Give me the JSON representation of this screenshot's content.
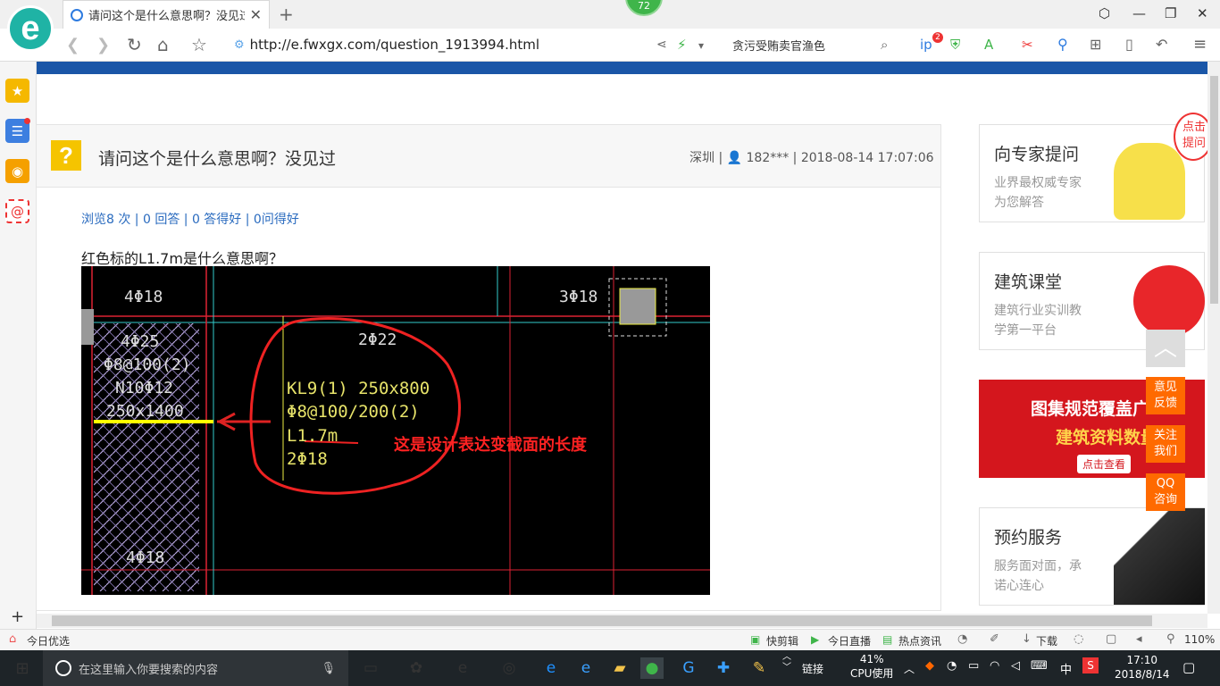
{
  "browser": {
    "tab_title": "请问这个是什么意思啊？没见过_",
    "tab_close": "✕",
    "new_tab": "+",
    "badge_count": "72",
    "url_display": "http://e.fwxgx.com/question_1913994.html",
    "search_value": "贪污受贿卖官渔色",
    "ext_badge": "2"
  },
  "question": {
    "title": "请问这个是什么意思啊？没见过",
    "meta": "深圳 | 👤 182*** | 2018-08-14 17:07:06",
    "stats": "浏览8 次 | 0 回答 | 0 答得好 | 0问得好",
    "body": "红色标的L1.7m是什么意思啊？",
    "icon_char": "?"
  },
  "cad_image": {
    "labels": [
      "4Φ18",
      "3Φ18",
      "4Φ25",
      "Φ8@100(2)",
      "N10Φ12",
      "250x1400",
      "2Φ22",
      "KL9(1) 250x800",
      "Φ8@100/200(2)",
      "L1.7m",
      "2Φ18",
      "4Φ18"
    ],
    "annotation": "这是设计表达变截面的长度"
  },
  "sidebar_cards": [
    {
      "title": "向专家提问",
      "sub": "业界最权威专家为您解答"
    },
    {
      "title": "建筑课堂",
      "sub": "建筑行业实训教学第一平台"
    },
    {
      "title": "预约服务",
      "sub": "服务面对面，承诺心连心"
    }
  ],
  "ad": {
    "line1": "图集规范覆盖广",
    "line2": "建筑资料数量",
    "cta": "点击查看"
  },
  "bubble": "点击提问",
  "float_buttons": [
    "意见反馈",
    "关注我们",
    "QQ咨询"
  ],
  "statusbar": {
    "left": "今日优选",
    "items": [
      "快剪辑",
      "今日直播",
      "热点资讯",
      "下载"
    ],
    "zoom": "110%"
  },
  "taskbar": {
    "search_placeholder": "在这里输入你要搜索的内容",
    "link": "链接",
    "cpu": "41%",
    "cpu_label": "CPU使用",
    "ime": "中",
    "time": "17:10",
    "date": "2018/8/14"
  },
  "colors": {
    "brand_blue": "#1a56a7",
    "accent_orange": "#ff6a00",
    "question_yellow": "#f5c400"
  }
}
